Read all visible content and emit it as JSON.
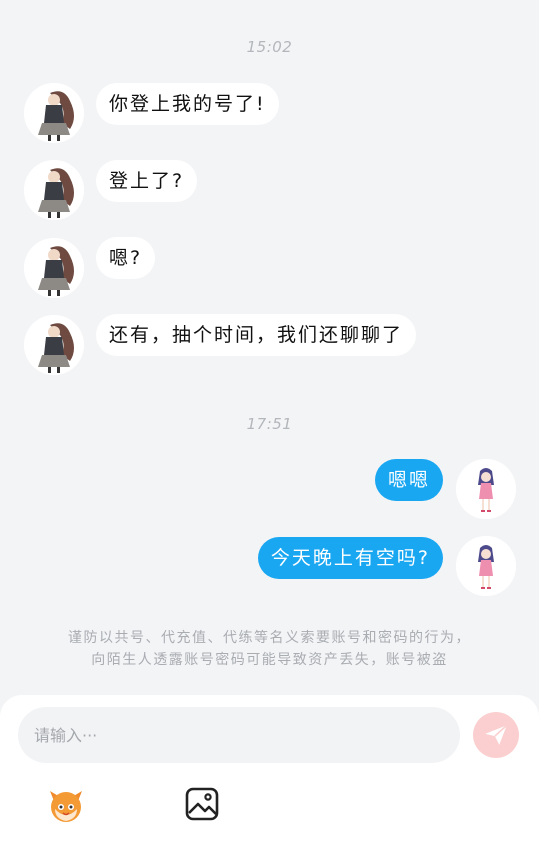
{
  "timestamps": [
    "15:02",
    "17:51"
  ],
  "messages_incoming": [
    {
      "text": "你登上我的号了!"
    },
    {
      "text": "登上了?"
    },
    {
      "text": "嗯?"
    },
    {
      "text": "还有，抽个时间，我们还聊聊了"
    }
  ],
  "messages_outgoing": [
    {
      "text": "嗯嗯"
    },
    {
      "text": "今天晚上有空吗?"
    }
  ],
  "notice": {
    "line1": "谨防以共号、代充值、代练等名义索要账号和密码的行为，",
    "line2": "向陌生人透露账号密码可能导致资产丢失，账号被盗"
  },
  "input": {
    "placeholder": "请输入···"
  },
  "colors": {
    "outgoing_bubble": "#1aa7f2",
    "send_button": "#fbcfcf",
    "background": "#f3f4f6"
  },
  "icons": {
    "send": "paper-plane-icon",
    "emoji": "mascot-emoji-icon",
    "image": "image-picker-icon"
  }
}
